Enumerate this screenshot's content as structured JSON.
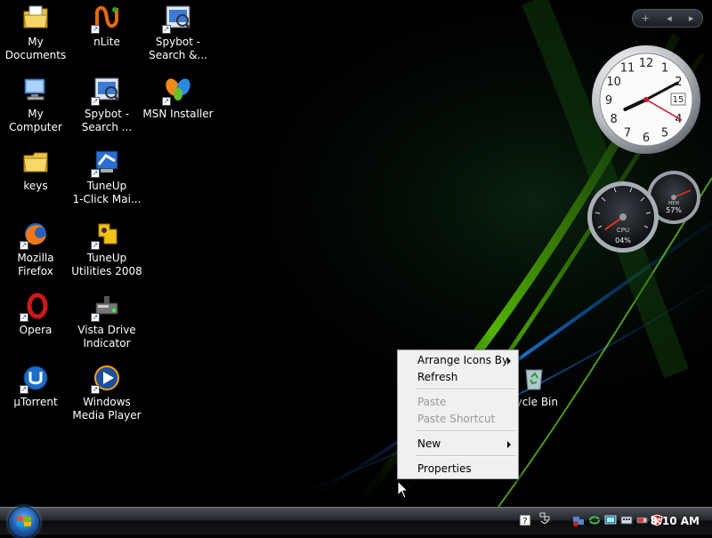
{
  "desktop": {
    "icons": [
      {
        "label": "My\nDocuments",
        "icon": "folder-documents-icon"
      },
      {
        "label": "nLite",
        "icon": "nlite-icon"
      },
      {
        "label": "Spybot -\nSearch &...",
        "icon": "spybot-icon"
      },
      {
        "label": "My Computer",
        "icon": "computer-icon"
      },
      {
        "label": "Spybot -\nSearch ...",
        "icon": "spybot-icon"
      },
      {
        "label": "MSN Installer",
        "icon": "msn-butterfly-icon"
      },
      {
        "label": "keys",
        "icon": "folder-icon"
      },
      {
        "label": "TuneUp\n1-Click Mai...",
        "icon": "tuneup-icon"
      },
      {
        "label": "Mozilla Firefox",
        "icon": "firefox-icon"
      },
      {
        "label": "TuneUp\nUtilities 2008",
        "icon": "tuneup-utilities-icon"
      },
      {
        "label": "Opera",
        "icon": "opera-icon"
      },
      {
        "label": "Vista Drive\nIndicator",
        "icon": "drive-icon"
      },
      {
        "label": "µTorrent",
        "icon": "utorrent-icon"
      },
      {
        "label": "Windows\nMedia Player",
        "icon": "media-player-icon"
      },
      {
        "label": "cycle Bin",
        "icon": "recycle-bin-icon"
      }
    ]
  },
  "sidebar": {
    "add_label": "+",
    "prev_label": "◂",
    "next_label": "▸",
    "clock": {
      "hour": 8,
      "minute": 10,
      "second": 20,
      "date": "15"
    },
    "meter": {
      "cpu_label": "CPU",
      "cpu_value": "04%",
      "mem_label": "MEM",
      "mem_value": "57%"
    }
  },
  "context_menu": {
    "items": [
      {
        "label": "Arrange Icons By",
        "enabled": true,
        "submenu": true
      },
      {
        "label": "Refresh",
        "enabled": true,
        "submenu": false
      },
      {
        "label": "Paste",
        "enabled": false,
        "submenu": false
      },
      {
        "label": "Paste Shortcut",
        "enabled": false,
        "submenu": false
      },
      {
        "label": "New",
        "enabled": true,
        "submenu": true
      },
      {
        "label": "Properties",
        "enabled": true,
        "submenu": false
      }
    ]
  },
  "taskbar": {
    "start_icon": "windows-logo-icon",
    "tray_icons": [
      "help-icon",
      "network-icon",
      "network-status-icon",
      "sync-icon",
      "monitor-icon",
      "keyboard-icon",
      "battery-icon",
      "security-shield-icon"
    ],
    "clock": "8:10 AM"
  },
  "colors": {
    "menu_bg": "#f0f0f0",
    "menu_disabled_text": "#9a9a9a",
    "wallpaper_green": "#5fd000",
    "wallpaper_blue": "#1e88ff"
  }
}
